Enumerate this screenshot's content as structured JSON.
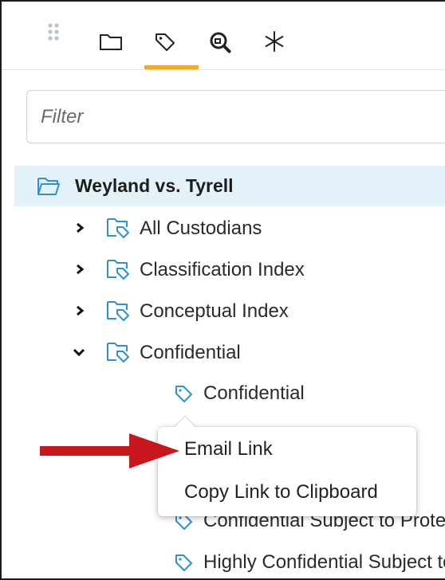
{
  "toolbar": {
    "icons": [
      "grip-icon",
      "folder-icon",
      "tag-icon",
      "search-file-icon",
      "asterisk-icon"
    ],
    "active_tab": "tag-icon",
    "accent_color": "#f5a623"
  },
  "filter": {
    "placeholder": "Filter",
    "value": ""
  },
  "tree": {
    "root": {
      "label": "Weyland vs. Tyrell",
      "icon": "folder-open-icon",
      "highlight_color": "#e3f1f8"
    },
    "folders": [
      {
        "label": "All Custodians",
        "expanded": false,
        "icon": "tag-folder-icon"
      },
      {
        "label": "Classification Index",
        "expanded": false,
        "icon": "tag-folder-icon"
      },
      {
        "label": "Conceptual Index",
        "expanded": false,
        "icon": "tag-folder-icon"
      },
      {
        "label": "Confidential",
        "expanded": true,
        "icon": "tag-folder-icon"
      }
    ],
    "tags": [
      {
        "label": "Confidential",
        "icon": "tag-icon"
      },
      {
        "label": "Confidential Subject to Protective Order",
        "icon": "tag-icon"
      },
      {
        "label": "Highly Confidential Subject to Protective Order",
        "icon": "tag-icon"
      }
    ],
    "icon_color": "#2f8fd0"
  },
  "context_menu": {
    "items": [
      "Email Link",
      "Copy Link to Clipboard"
    ]
  },
  "annotation": {
    "arrow_color": "#c8161d",
    "icon": "arrow-right-icon"
  }
}
